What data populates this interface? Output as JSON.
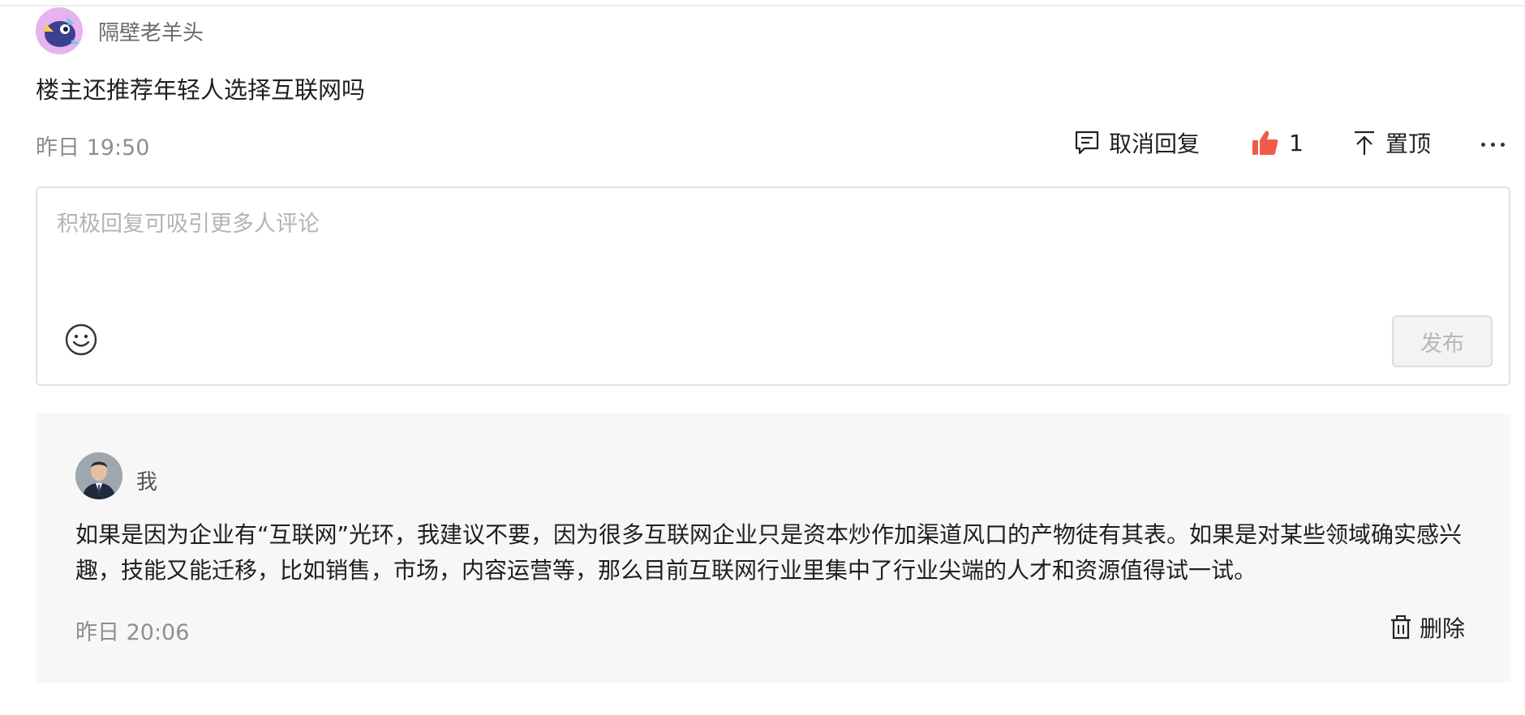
{
  "comment": {
    "username": "隔壁老羊头",
    "text": "楼主还推荐年轻人选择互联网吗",
    "time": "昨日 19:50",
    "actions": {
      "cancel_reply": "取消回复",
      "like_count": "1",
      "pin": "置顶"
    },
    "like_color": "#f05a4a"
  },
  "editor": {
    "placeholder": "积极回复可吸引更多人评论",
    "value": "",
    "publish": "发布"
  },
  "reply": {
    "username": "我",
    "text": "如果是因为企业有“互联网”光环，我建议不要，因为很多互联网企业只是资本炒作加渠道风口的产物徒有其表。如果是对某些领域确实感兴趣，技能又能迁移，比如销售，市场，内容运营等，那么目前互联网行业里集中了行业尖端的人才和资源值得试一试。",
    "time": "昨日 20:06",
    "delete": "删除"
  }
}
